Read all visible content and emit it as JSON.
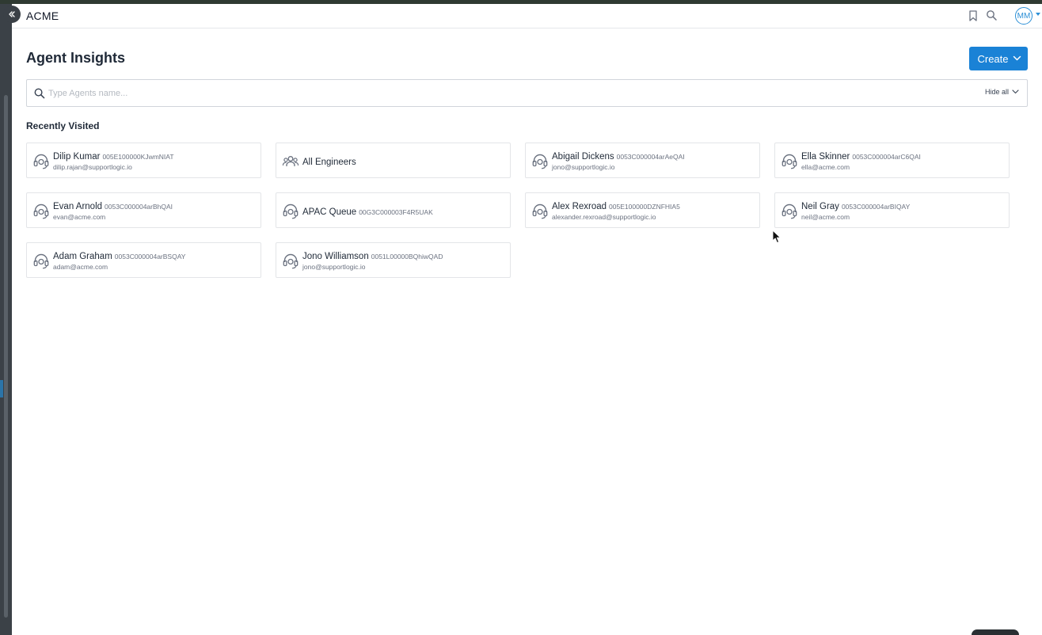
{
  "app": {
    "brand": "ACME"
  },
  "header": {
    "avatar_initials": "MM"
  },
  "page": {
    "title": "Agent Insights",
    "create_label": "Create"
  },
  "search": {
    "placeholder": "Type Agents name...",
    "value": "",
    "hide_all_label": "Hide all"
  },
  "recent": {
    "title": "Recently Visited",
    "items": [
      {
        "name": "Dilip Kumar",
        "id": "005E100000KJwmNIAT",
        "email": "dilip.rajan@supportlogic.io",
        "icon": "headset-icon"
      },
      {
        "name": "All Engineers",
        "id": "",
        "email": "",
        "icon": "users-icon"
      },
      {
        "name": "Abigail Dickens",
        "id": "0053C000004arAeQAI",
        "email": "jono@supportlogic.io",
        "icon": "headset-icon"
      },
      {
        "name": "Ella Skinner",
        "id": "0053C000004arC6QAI",
        "email": "ella@acme.com",
        "icon": "headset-icon"
      },
      {
        "name": "Evan Arnold",
        "id": "0053C000004arBhQAI",
        "email": "evan@acme.com",
        "icon": "headset-icon"
      },
      {
        "name": "APAC Queue",
        "id": "00G3C000003F4R5UAK",
        "email": "",
        "icon": "headset-icon"
      },
      {
        "name": "Alex Rexroad",
        "id": "005E100000DZNFHIA5",
        "email": "alexander.rexroad@supportlogic.io",
        "icon": "headset-icon"
      },
      {
        "name": "Neil Gray",
        "id": "0053C000004arBIQAY",
        "email": "neil@acme.com",
        "icon": "headset-icon"
      },
      {
        "name": "Adam Graham",
        "id": "0053C000004arBSQAY",
        "email": "adam@acme.com",
        "icon": "headset-icon"
      },
      {
        "name": "Jono Williamson",
        "id": "0051L00000BQhiwQAD",
        "email": "jono@supportlogic.io",
        "icon": "headset-icon"
      }
    ]
  },
  "colors": {
    "accent": "#1a82d6",
    "avatar": "#2b8fd6",
    "icon_gray": "#6b7280"
  }
}
